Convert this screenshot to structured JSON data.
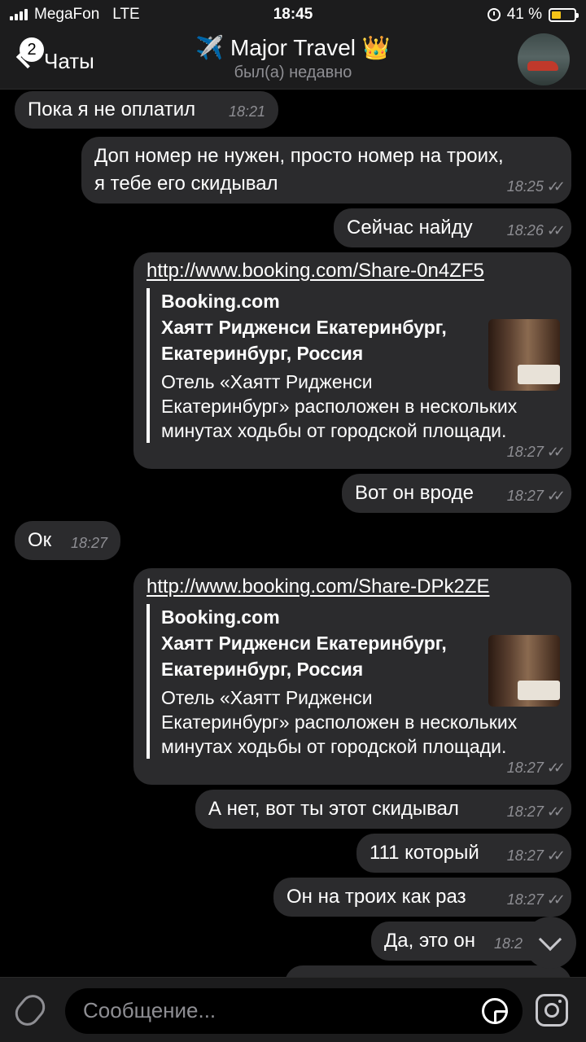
{
  "status": {
    "carrier": "MegaFon",
    "network": "LTE",
    "time": "18:45",
    "battery": "41 %",
    "battery_level": 0.41
  },
  "header": {
    "back_label": "Чаты",
    "unread_count": "2",
    "title": "✈️ Major Travel 👑",
    "subtitle": "был(а) недавно"
  },
  "messages": [
    {
      "text": "Пока я не оплатил",
      "time": "18:21"
    },
    {
      "text_lines": [
        "Доп номер не нужен, просто номер на троих,",
        "я тебе его скидывал"
      ],
      "time": "18:25"
    },
    {
      "text": "Сейчас найду",
      "time": "18:26"
    },
    {
      "link": "http://www.booking.com/Share-0n4ZF5",
      "preview": {
        "site": "Booking.com",
        "title_lines": [
          "Хаятт Ридженси Екатеринбург,",
          "Екатеринбург, Россия"
        ],
        "desc_lines": [
          "Отель «Хаятт Ридженси",
          "Екатеринбург» расположен в нескольких",
          "минутах ходьбы от городской площади."
        ]
      },
      "time": "18:27"
    },
    {
      "text": "Вот он вроде",
      "time": "18:27"
    },
    {
      "text": "Ок",
      "time": "18:27"
    },
    {
      "link": "http://www.booking.com/Share-DPk2ZE",
      "preview": {
        "site": "Booking.com",
        "title_lines": [
          "Хаятт Ридженси Екатеринбург,",
          "Екатеринбург, Россия"
        ],
        "desc_lines": [
          "Отель «Хаятт Ридженси",
          "Екатеринбург» расположен в нескольких",
          "минутах ходьбы от городской площади."
        ]
      },
      "time": "18:27"
    },
    {
      "text": "А нет, вот ты этот скидывал",
      "time": "18:27"
    },
    {
      "text": "111 который",
      "time": "18:27"
    },
    {
      "text": "Он на троих как раз",
      "time": "18:27"
    },
    {
      "text": "Да, это он",
      "time": "18:2"
    }
  ],
  "read_mark": "✓✓",
  "input": {
    "placeholder": "Сообщение..."
  },
  "icons": {
    "attach": "paperclip-icon",
    "sticker": "sticker-icon",
    "camera": "camera-icon",
    "scroll": "chevron-down-icon"
  }
}
